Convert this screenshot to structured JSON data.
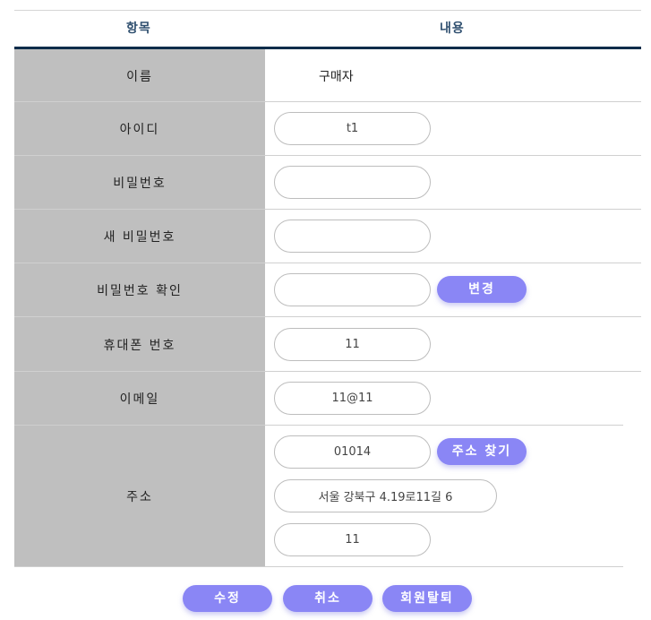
{
  "table": {
    "header": {
      "item": "항목",
      "content": "내용"
    },
    "rows": {
      "name": {
        "label": "이름",
        "value": "구매자"
      },
      "user_id": {
        "label": "아이디",
        "value": "t1"
      },
      "password": {
        "label": "비밀번호",
        "value": ""
      },
      "new_password": {
        "label": "새 비밀번호",
        "value": ""
      },
      "confirm_password": {
        "label": "비밀번호 확인",
        "value": "",
        "change_button": "변경"
      },
      "phone": {
        "label": "휴대폰 번호",
        "value": "11"
      },
      "email": {
        "label": "이메일",
        "value": "11@11"
      },
      "address": {
        "label": "주소",
        "postcode": "01014",
        "search_button": "주소 찾기",
        "road_address": "서울 강북구 4.19로11길 6",
        "detail": "11"
      }
    }
  },
  "actions": {
    "modify": "수정",
    "cancel": "취소",
    "withdraw": "회원탈퇴"
  },
  "colors": {
    "accent": "#8a86f5",
    "label_bg": "#bfbfbf",
    "header_rule": "#0d2c4a",
    "header_text": "#2f4f6f"
  }
}
